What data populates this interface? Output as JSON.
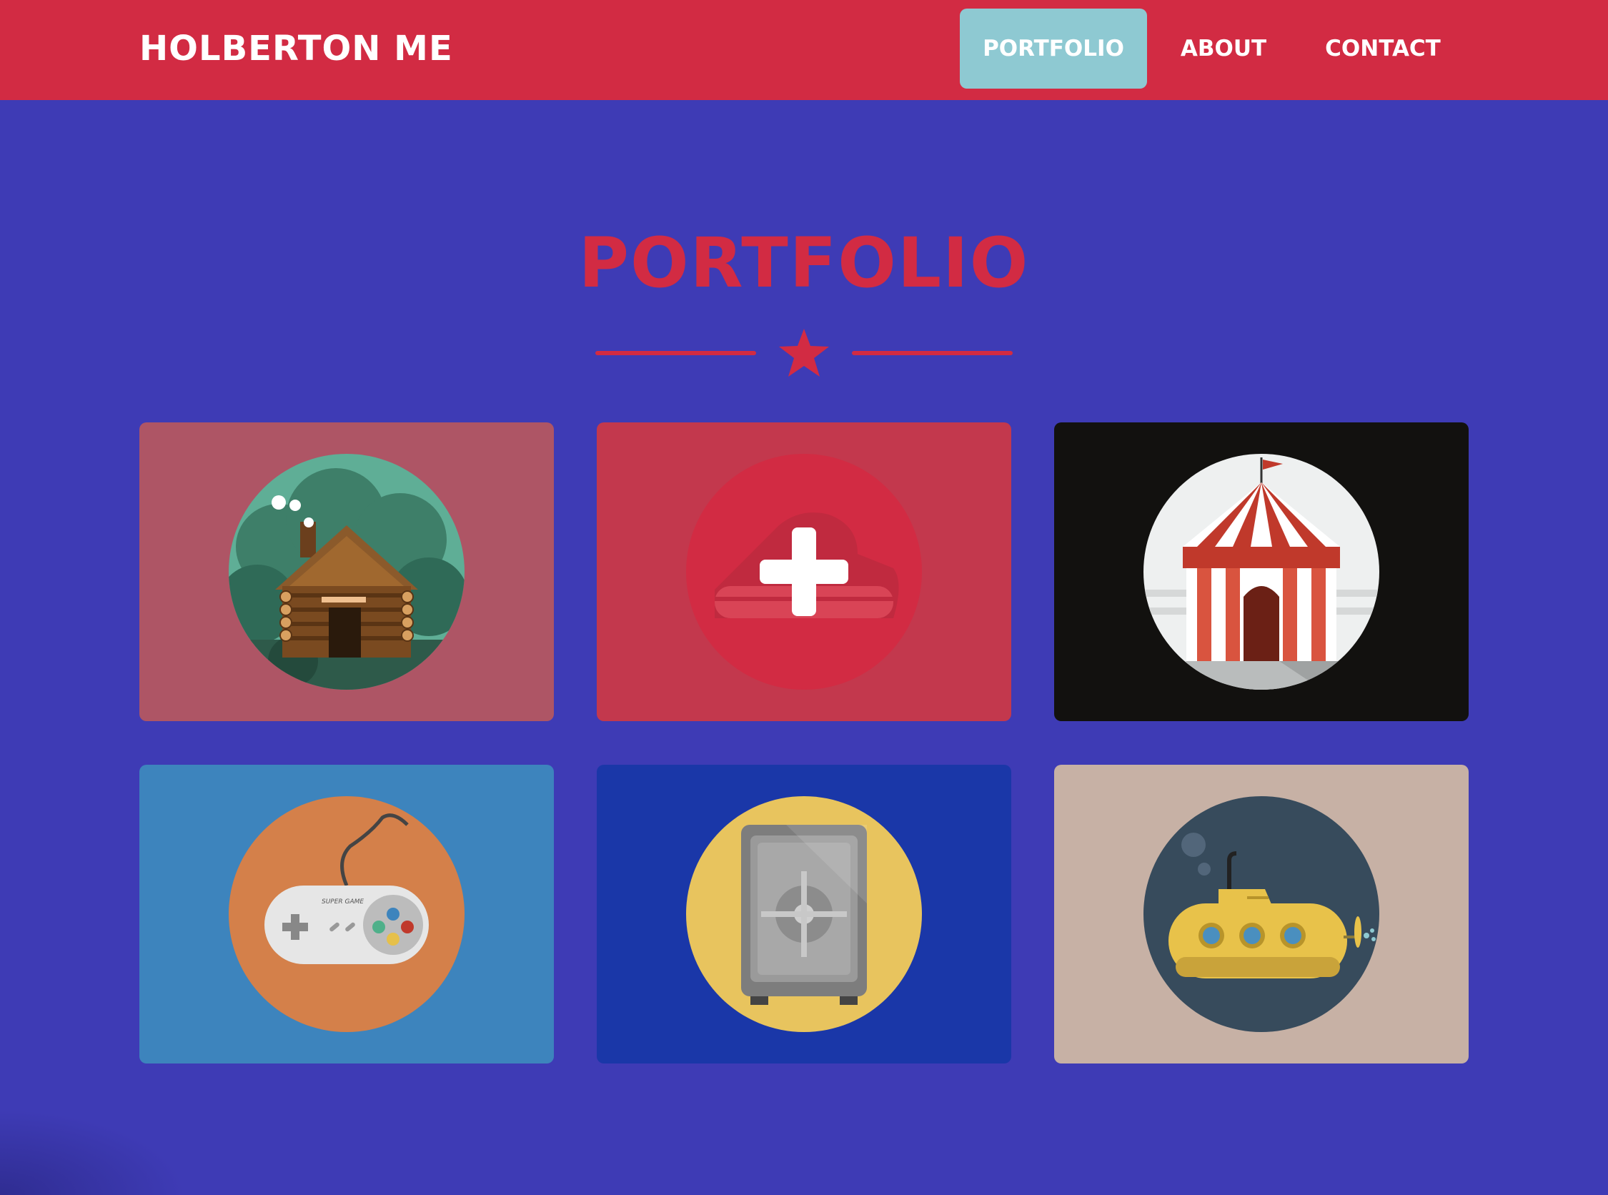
{
  "navbar": {
    "brand": "HOLBERTON ME",
    "items": [
      {
        "label": "PORTFOLIO",
        "active": true
      },
      {
        "label": "ABOUT",
        "active": false
      },
      {
        "label": "CONTACT",
        "active": false
      }
    ]
  },
  "portfolio": {
    "title": "PORTFOLIO",
    "divider_icon": "star-icon",
    "items": [
      {
        "icon": "cabin-icon",
        "background": "#ae5565",
        "hover_overlay": false
      },
      {
        "icon": "cake-icon",
        "background": "#c3384d",
        "hover_overlay": true,
        "overlay_icon": "plus-icon"
      },
      {
        "icon": "circus-tent-icon",
        "background": "#12110f",
        "hover_overlay": false
      },
      {
        "icon": "game-controller-icon",
        "background": "#3d84bd",
        "hover_overlay": false,
        "label_on_icon": "SUPER GAME"
      },
      {
        "icon": "safe-icon",
        "background": "#1a37a8",
        "hover_overlay": false
      },
      {
        "icon": "submarine-icon",
        "background": "#c7b1a5",
        "hover_overlay": false
      }
    ]
  },
  "colors": {
    "navbar": "#d22b43",
    "page": "#3e3bb5",
    "accent": "#d22b43",
    "active_nav": "#8ec9d2",
    "text_light": "#ffffff"
  }
}
